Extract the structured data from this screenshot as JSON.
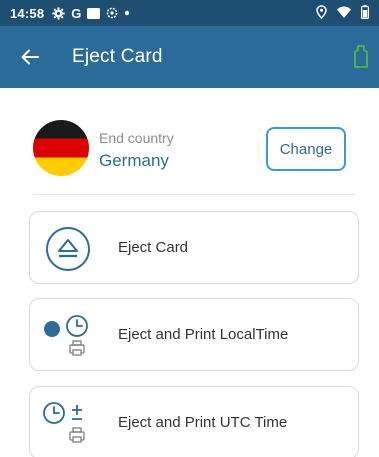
{
  "status_bar": {
    "time": "14:58",
    "left_icons": [
      "gear-icon",
      "google-icon",
      "square-icon",
      "settings-icon",
      "dot-icon"
    ],
    "right_icons": [
      "location-icon",
      "wifi-icon",
      "battery-icon"
    ]
  },
  "app_bar": {
    "title": "Eject Card",
    "back_icon": "arrow-left-icon",
    "right_icon": "battery-outline-icon"
  },
  "country": {
    "label": "End country",
    "name": "Germany",
    "flag": "germany-flag",
    "change_button": "Change"
  },
  "actions": [
    {
      "label": "Eject Card",
      "icon": "eject-icon"
    },
    {
      "label": "Eject and Print LocalTime",
      "icon": "clock-print-local-icon"
    },
    {
      "label": "Eject and Print UTC Time",
      "icon": "clock-print-utc-icon"
    }
  ],
  "colors": {
    "status_bar": "#1e4f72",
    "app_bar": "#2c6b99",
    "accent": "#2c6b99",
    "button_border": "#3a9ad9",
    "battery_icon": "#4caf50"
  }
}
